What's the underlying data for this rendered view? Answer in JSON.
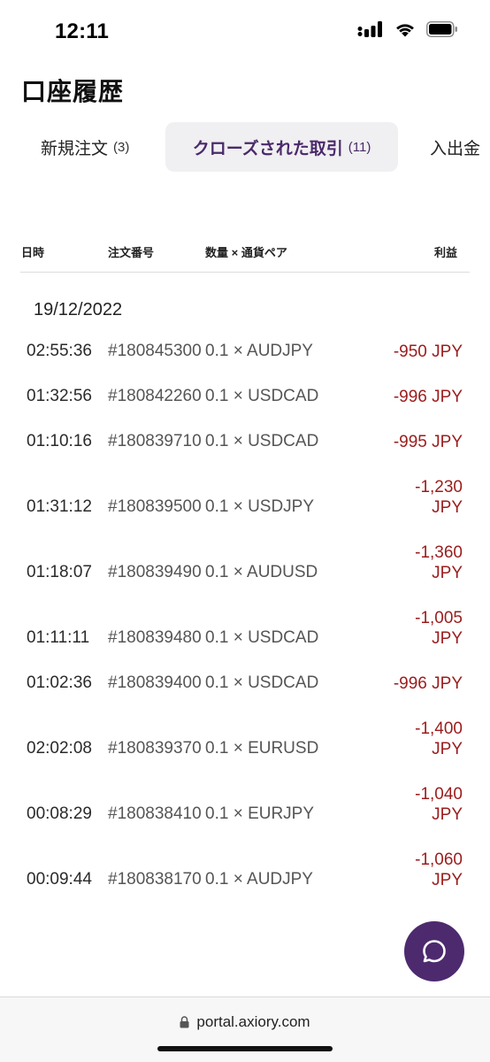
{
  "status_bar": {
    "time": "12:11",
    "icons": [
      "signal-icon",
      "wifi-icon",
      "battery-icon"
    ]
  },
  "page": {
    "title": "口座履歴"
  },
  "tabs": [
    {
      "label": "新規注文",
      "count": "(3)"
    },
    {
      "label": "クローズされた取引",
      "count": "(11)"
    },
    {
      "label": "入出金",
      "count": ""
    }
  ],
  "table": {
    "headers": {
      "date": "日時",
      "order": "注文番号",
      "qty_pair": "数量 × 通貨ペア",
      "profit": "利益"
    },
    "group_date": "19/12/2022",
    "rows": [
      {
        "time": "02:55:36",
        "order": "#180845300",
        "pair": "0.1 × AUDJPY",
        "profit": "-950 JPY"
      },
      {
        "time": "01:32:56",
        "order": "#180842260",
        "pair": "0.1 × USDCAD",
        "profit": "-996 JPY"
      },
      {
        "time": "01:10:16",
        "order": "#180839710",
        "pair": "0.1 × USDCAD",
        "profit": "-995 JPY"
      },
      {
        "time": "01:31:12",
        "order": "#180839500",
        "pair": "0.1 × USDJPY",
        "profit": "-1,230 JPY"
      },
      {
        "time": "01:18:07",
        "order": "#180839490",
        "pair": "0.1 × AUDUSD",
        "profit": "-1,360 JPY"
      },
      {
        "time": "01:11:11",
        "order": "#180839480",
        "pair": "0.1 × USDCAD",
        "profit": "-1,005 JPY"
      },
      {
        "time": "01:02:36",
        "order": "#180839400",
        "pair": "0.1 × USDCAD",
        "profit": "-996 JPY"
      },
      {
        "time": "02:02:08",
        "order": "#180839370",
        "pair": "0.1 × EURUSD",
        "profit": "-1,400 JPY"
      },
      {
        "time": "00:08:29",
        "order": "#180838410",
        "pair": "0.1 × EURJPY",
        "profit": "-1,040 JPY"
      },
      {
        "time": "00:09:44",
        "order": "#180838170",
        "pair": "0.1 × AUDJPY",
        "profit": "-1,060 JPY"
      }
    ]
  },
  "chat": {
    "icon": "chat-bubble-icon"
  },
  "browser": {
    "url": "portal.axiory.com",
    "lock_icon": "lock-icon"
  },
  "colors": {
    "accent": "#4d2a6e",
    "loss": "#9b1c1c",
    "tab_active_bg": "#f0eff1"
  }
}
